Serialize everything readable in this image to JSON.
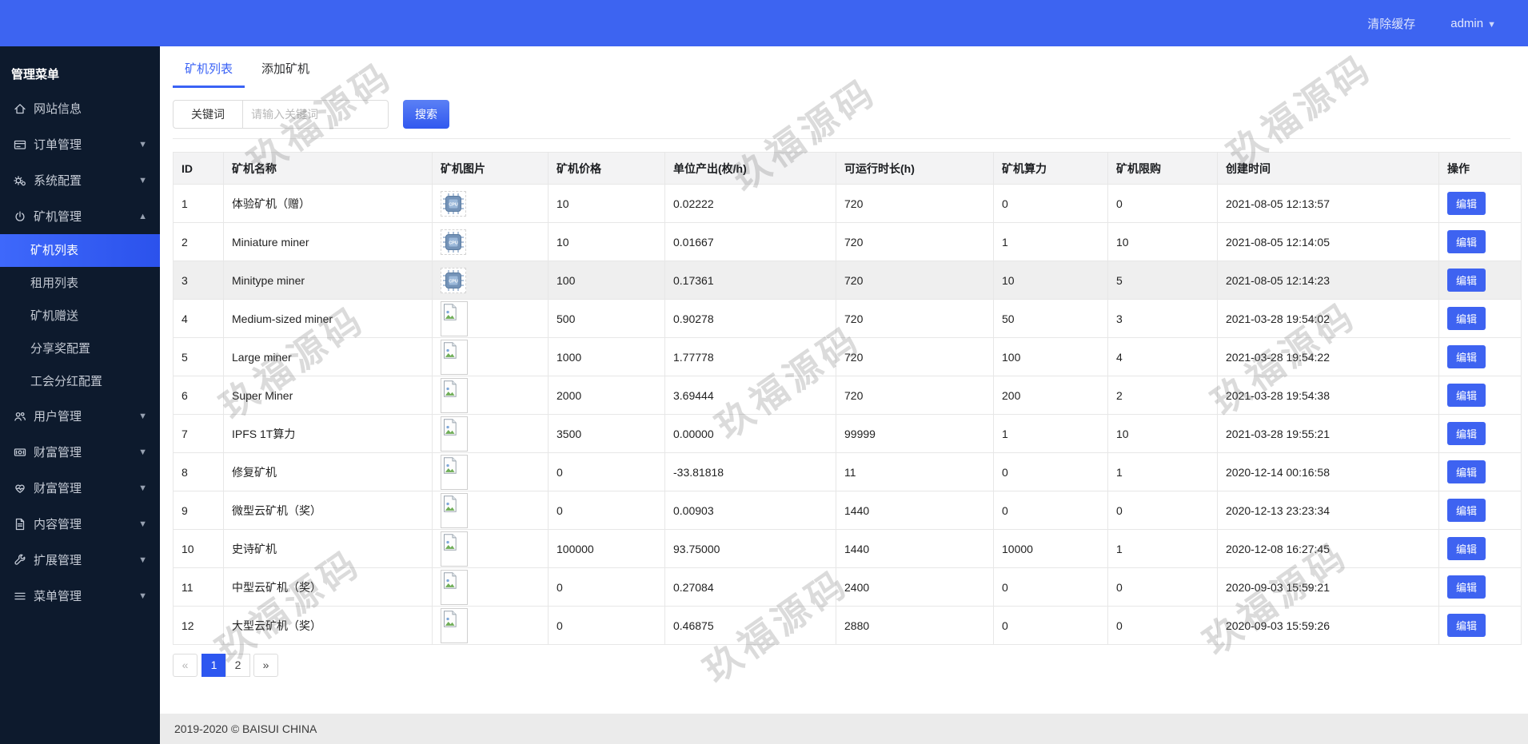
{
  "topbar": {
    "clear_cache": "清除缓存",
    "username": "admin"
  },
  "sidebar": {
    "items": [
      {
        "type": "header",
        "label": "管理菜单"
      },
      {
        "type": "item",
        "key": "site-info",
        "icon": "home",
        "label": "网站信息"
      },
      {
        "type": "item",
        "key": "order-mgmt",
        "icon": "orders",
        "label": "订单管理",
        "caret": "down"
      },
      {
        "type": "item",
        "key": "system-config",
        "icon": "gears",
        "label": "系统配置",
        "caret": "down"
      },
      {
        "type": "item",
        "key": "miner-mgmt",
        "icon": "power",
        "label": "矿机管理",
        "caret": "up"
      },
      {
        "type": "subitem",
        "key": "miner-list",
        "label": "矿机列表",
        "active": true
      },
      {
        "type": "subitem",
        "key": "rental-list",
        "label": "租用列表"
      },
      {
        "type": "subitem",
        "key": "miner-gift",
        "label": "矿机赠送"
      },
      {
        "type": "subitem",
        "key": "share-reward",
        "label": "分享奖配置"
      },
      {
        "type": "subitem",
        "key": "guild-dividend",
        "label": "工会分红配置"
      },
      {
        "type": "item",
        "key": "user-mgmt",
        "icon": "users",
        "label": "用户管理",
        "caret": "down"
      },
      {
        "type": "item",
        "key": "wealth-mgmt-1",
        "icon": "money",
        "label": "财富管理",
        "caret": "down"
      },
      {
        "type": "item",
        "key": "wealth-mgmt-2",
        "icon": "heart",
        "label": "财富管理",
        "caret": "down"
      },
      {
        "type": "item",
        "key": "content-mgmt",
        "icon": "file",
        "label": "内容管理",
        "caret": "down"
      },
      {
        "type": "item",
        "key": "extension-mgmt",
        "icon": "wrench",
        "label": "扩展管理",
        "caret": "down"
      },
      {
        "type": "item",
        "key": "menu-mgmt",
        "icon": "bars",
        "label": "菜单管理",
        "caret": "down"
      }
    ]
  },
  "tabs": [
    {
      "label": "矿机列表",
      "active": true
    },
    {
      "label": "添加矿机",
      "active": false
    }
  ],
  "search": {
    "label": "关键词",
    "placeholder": "请输入关键词",
    "button": "搜索"
  },
  "table": {
    "headers": [
      "ID",
      "矿机名称",
      "矿机图片",
      "矿机价格",
      "单位产出(枚/h)",
      "可运行时长(h)",
      "矿机算力",
      "矿机限购",
      "创建时间",
      "操作"
    ],
    "edit_label": "编辑",
    "image_icons": {
      "cpu": "cpu-chip-icon",
      "broken": "broken-image-icon"
    },
    "rows": [
      {
        "id": "1",
        "name": "体验矿机（赠）",
        "image": "cpu",
        "price": "10",
        "output": "0.02222",
        "runtime": "720",
        "power": "0",
        "limit": "0",
        "created": "2021-08-05 12:13:57"
      },
      {
        "id": "2",
        "name": "Miniature miner",
        "image": "cpu",
        "price": "10",
        "output": "0.01667",
        "runtime": "720",
        "power": "1",
        "limit": "10",
        "created": "2021-08-05 12:14:05"
      },
      {
        "id": "3",
        "name": "Minitype miner",
        "image": "cpu",
        "price": "100",
        "output": "0.17361",
        "runtime": "720",
        "power": "10",
        "limit": "5",
        "created": "2021-08-05 12:14:23",
        "highlight": true
      },
      {
        "id": "4",
        "name": "Medium-sized miner",
        "image": "broken",
        "price": "500",
        "output": "0.90278",
        "runtime": "720",
        "power": "50",
        "limit": "3",
        "created": "2021-03-28 19:54:02"
      },
      {
        "id": "5",
        "name": "Large miner",
        "image": "broken",
        "price": "1000",
        "output": "1.77778",
        "runtime": "720",
        "power": "100",
        "limit": "4",
        "created": "2021-03-28 19:54:22"
      },
      {
        "id": "6",
        "name": "Super Miner",
        "image": "broken",
        "price": "2000",
        "output": "3.69444",
        "runtime": "720",
        "power": "200",
        "limit": "2",
        "created": "2021-03-28 19:54:38"
      },
      {
        "id": "7",
        "name": "IPFS 1T算力",
        "image": "broken",
        "price": "3500",
        "output": "0.00000",
        "runtime": "99999",
        "power": "1",
        "limit": "10",
        "created": "2021-03-28 19:55:21"
      },
      {
        "id": "8",
        "name": "修复矿机",
        "image": "broken",
        "price": "0",
        "output": "-33.81818",
        "runtime": "11",
        "power": "0",
        "limit": "1",
        "created": "2020-12-14 00:16:58"
      },
      {
        "id": "9",
        "name": "微型云矿机（奖）",
        "image": "broken",
        "price": "0",
        "output": "0.00903",
        "runtime": "1440",
        "power": "0",
        "limit": "0",
        "created": "2020-12-13 23:23:34"
      },
      {
        "id": "10",
        "name": "史诗矿机",
        "image": "broken",
        "price": "100000",
        "output": "93.75000",
        "runtime": "1440",
        "power": "10000",
        "limit": "1",
        "created": "2020-12-08 16:27:45"
      },
      {
        "id": "11",
        "name": "中型云矿机（奖）",
        "image": "broken",
        "price": "0",
        "output": "0.27084",
        "runtime": "2400",
        "power": "0",
        "limit": "0",
        "created": "2020-09-03 15:59:21"
      },
      {
        "id": "12",
        "name": "大型云矿机（奖）",
        "image": "broken",
        "price": "0",
        "output": "0.46875",
        "runtime": "2880",
        "power": "0",
        "limit": "0",
        "created": "2020-09-03 15:59:26"
      }
    ]
  },
  "pagination": {
    "prev": "«",
    "pages": [
      "1",
      "2"
    ],
    "active": "1",
    "next": "»"
  },
  "footer": {
    "copyright": "2019-2020 © BAISUI CHINA"
  },
  "watermark": {
    "text": "玖福源码"
  },
  "colors": {
    "accent": "#3d64f1",
    "sidebar_bg": "#0d1a2d",
    "active_item": "#2d57f0",
    "footer_bg": "#ebebeb"
  }
}
